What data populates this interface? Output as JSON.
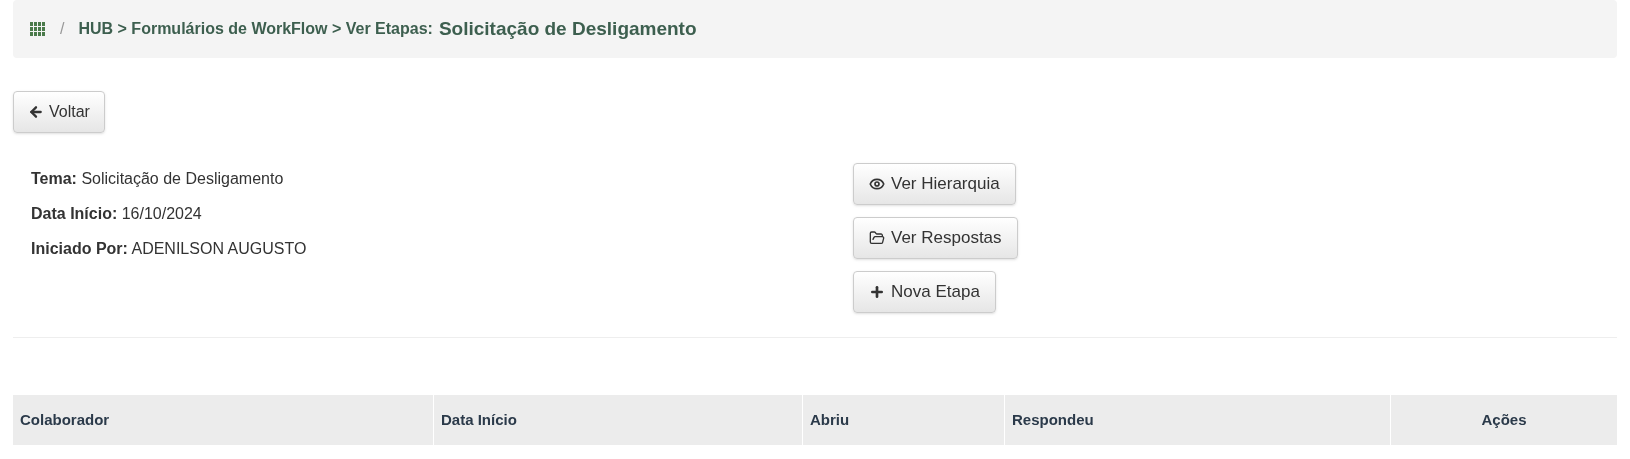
{
  "breadcrumb": {
    "separator": "/",
    "path": "HUB > Formulários de WorkFlow > Ver Etapas:",
    "title": "Solicitação de Desligamento"
  },
  "back_button": "Voltar",
  "info": [
    {
      "label": "Tema:",
      "value": "Solicitação de Desligamento"
    },
    {
      "label": "Data Início:",
      "value": "16/10/2024"
    },
    {
      "label": "Iniciado Por:",
      "value": "ADENILSON AUGUSTO"
    }
  ],
  "actions": [
    {
      "kind": "eye",
      "label": "Ver Hierarquia"
    },
    {
      "kind": "folder",
      "label": "Ver Respostas"
    },
    {
      "kind": "plus",
      "label": "Nova Etapa"
    }
  ],
  "table": {
    "columns": [
      "Colaborador",
      "Data Início",
      "Abriu",
      "Respondeu",
      "Ações"
    ]
  }
}
